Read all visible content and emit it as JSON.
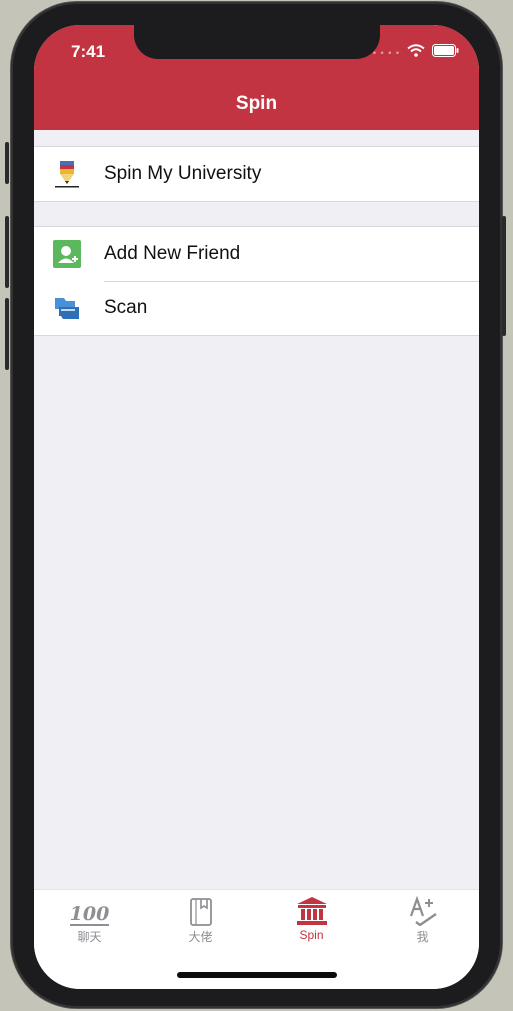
{
  "status_bar": {
    "time": "7:41"
  },
  "nav": {
    "title": "Spin"
  },
  "sections": [
    {
      "items": [
        {
          "label": "Spin My University",
          "icon": "pencil-icon"
        }
      ]
    },
    {
      "items": [
        {
          "label": "Add New Friend",
          "icon": "add-contact-icon"
        },
        {
          "label": "Scan",
          "icon": "scan-icon"
        }
      ]
    }
  ],
  "tabs": [
    {
      "label": "聊天",
      "icon_text": "100",
      "icon": "hundred-points-icon",
      "active": false
    },
    {
      "label": "大佬",
      "icon": "book-icon",
      "active": false
    },
    {
      "label": "Spin",
      "icon": "bank-building-icon",
      "active": true
    },
    {
      "label": "我",
      "icon": "a-plus-icon",
      "active": false
    }
  ],
  "colors": {
    "accent": "#c23442",
    "background": "#efeff4",
    "tab_inactive": "#8e8e93"
  }
}
